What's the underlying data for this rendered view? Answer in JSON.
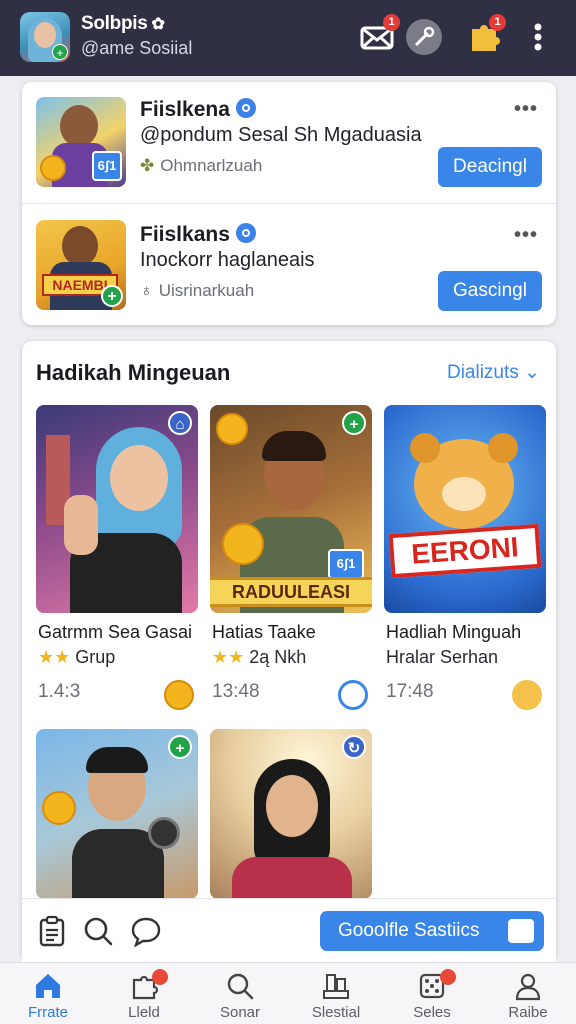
{
  "header": {
    "title": "Solbpis",
    "title_icon": "flower-icon",
    "subtitle": "@ame Sosiial",
    "notif_messages": "1",
    "notif_rewards": "1"
  },
  "users": [
    {
      "name": "Fiislkena",
      "handle": "@pondum Sesal Sh Mgaduasia",
      "meta": "Ohmnarlzuah",
      "badge": "6ʃ1",
      "action": "Deacingl"
    },
    {
      "name": "Fiislkans",
      "handle": "Inockorr haglaneais",
      "meta": "Uisrinarkuah",
      "banner": "NAEMBI",
      "action": "Gascingl"
    }
  ],
  "section": {
    "title": "Hadikah Mingeuan",
    "link": "Dializuts",
    "tiles": [
      {
        "title": "Gatrmm Sea Gasai",
        "sub": "Grup",
        "stars": "★★",
        "time": "1.4:3"
      },
      {
        "title": "Hatias Taake",
        "sub": "2ą Nkh",
        "stars": "★★",
        "time": "13:48",
        "banner": "RADUULEASI",
        "badge": "6ʃ1"
      },
      {
        "title": "Hadliah Minguah",
        "sub": "Hralar Serhan",
        "time": "17:48",
        "banner": "EERONI"
      }
    ]
  },
  "action_bar": {
    "button": "Gooolfle Sastiics"
  },
  "bottom_nav": [
    {
      "label": "Frrate",
      "icon": "home-icon",
      "active": true
    },
    {
      "label": "Lleld",
      "icon": "puzzle-icon",
      "badge": ""
    },
    {
      "label": "Sonar",
      "icon": "search-icon"
    },
    {
      "label": "Slestial",
      "icon": "trophy-icon"
    },
    {
      "label": "Seles",
      "icon": "dice-icon",
      "badge": ""
    },
    {
      "label": "Raibe",
      "icon": "profile-icon"
    }
  ],
  "colors": {
    "header_bg": "#2f3044",
    "accent": "#3a86e8",
    "notif": "#e33a3a"
  }
}
